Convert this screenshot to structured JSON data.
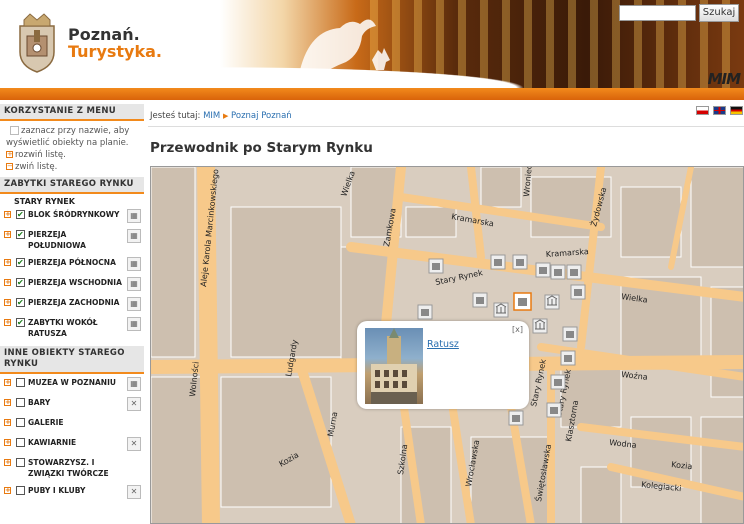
{
  "header": {
    "logo_line1": "Poznań.",
    "logo_line2": "Turystyka.",
    "brand_right": "MIM",
    "search_placeholder": "",
    "search_button": "Szukaj"
  },
  "sidebar": {
    "menu_heading": "KORZYSTANIE Z MENU",
    "help_line1": "zaznacz przy nazwie, aby",
    "help_line2": "wyświetlić obiekty na planie.",
    "expand_label": "rozwiń listę.",
    "collapse_label": "zwiń listę.",
    "section1_heading": "ZABYTKI STAREGO RYNKU",
    "section1_sub": "STARY RYNEK",
    "section1_items": [
      {
        "label": "BLOK ŚRÓDRYNKOWY",
        "checked": true,
        "icon": "building-icon"
      },
      {
        "label": "PIERZEJA POŁUDNIOWA",
        "checked": true,
        "icon": "building-icon"
      },
      {
        "label": "PIERZEJA PÓŁNOCNA",
        "checked": true,
        "icon": "building-icon"
      },
      {
        "label": "PIERZEJA WSCHODNIA",
        "checked": true,
        "icon": "building-icon"
      },
      {
        "label": "PIERZEJA ZACHODNIA",
        "checked": true,
        "icon": "building-icon"
      },
      {
        "label": "ZABYTKI WOKÓŁ RATUSZA",
        "checked": true,
        "icon": "monument-icon"
      }
    ],
    "section2_heading": "INNE OBIEKTY STAREGO RYNKU",
    "section2_items": [
      {
        "label": "MUZEA W POZNANIU",
        "checked": false,
        "icon": "museum-icon"
      },
      {
        "label": "BARY",
        "checked": false,
        "icon": "cutlery-icon"
      },
      {
        "label": "GALERIE",
        "checked": false,
        "icon": ""
      },
      {
        "label": "KAWIARNIE",
        "checked": false,
        "icon": "cutlery-icon"
      },
      {
        "label": "STOWARZYSZ. I ZWIĄZKI TWÓRCZE",
        "checked": false,
        "icon": ""
      },
      {
        "label": "PUBY I KLUBY",
        "checked": false,
        "icon": "cutlery-icon"
      }
    ]
  },
  "breadcrumb": {
    "prefix": "Jesteś tutaj:",
    "items": [
      "MIM",
      "Poznaj Poznań"
    ]
  },
  "page_title": "Przewodnik po Starym Rynku",
  "map": {
    "streets": [
      "Aleje Karola Marcinkowskiego",
      "Wielka",
      "Kramarska",
      "Żydowska",
      "Wroniecka",
      "Zamkowa",
      "Stary Rynek",
      "Wielka",
      "Wolności",
      "Ludgardy",
      "Murna",
      "Kozia",
      "Szkolna",
      "Wrocławska",
      "Świętosławska",
      "Klasztorna",
      "Woźna",
      "Wodna",
      "Kozia",
      "Kolegiacki",
      "Stary Rynek",
      "Stary Rynek",
      "Kramarska"
    ],
    "popup_title": "Ratusz",
    "popup_close": "[x]",
    "colors": {
      "land": "#d9cdbf",
      "block": "#cdbfaf",
      "street": "#f7c98a",
      "edge": "#ffffff"
    }
  }
}
